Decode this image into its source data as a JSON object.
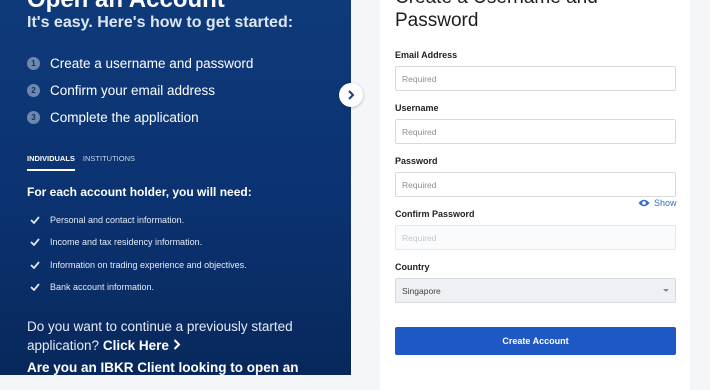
{
  "left_panel": {
    "title": "Open an Account",
    "subtitle": "It's easy. Here's how to get started:",
    "steps": [
      {
        "num": "1",
        "label": "Create a username and password"
      },
      {
        "num": "2",
        "label": "Confirm your email address"
      },
      {
        "num": "3",
        "label": "Complete the application"
      }
    ],
    "tabs": [
      {
        "label": "INDIVIDUALS",
        "active": true
      },
      {
        "label": "INSTITUTIONS",
        "active": false
      }
    ],
    "need_title": "For each account holder, you will need:",
    "needs": [
      "Personal and contact information.",
      "Income and tax residency information.",
      "Information on trading experience and objectives.",
      "Bank account information."
    ],
    "continue_question": "Do you want to continue a previously started application?",
    "continue_link": "Click Here",
    "client_question": "Are you an IBKR Client looking to open an"
  },
  "form": {
    "title": "Create a Username and Password",
    "email_label": "Email Address",
    "email_placeholder": "Required",
    "username_label": "Username",
    "username_placeholder": "Required",
    "password_label": "Password",
    "password_placeholder": "Required",
    "show_label": "Show",
    "confirm_label": "Confirm Password",
    "confirm_placeholder": "Required",
    "country_label": "Country",
    "country_value": "Singapore",
    "submit_label": "Create Account"
  },
  "colors": {
    "panel_bg": "#0b3270",
    "accent": "#1d58c4"
  }
}
